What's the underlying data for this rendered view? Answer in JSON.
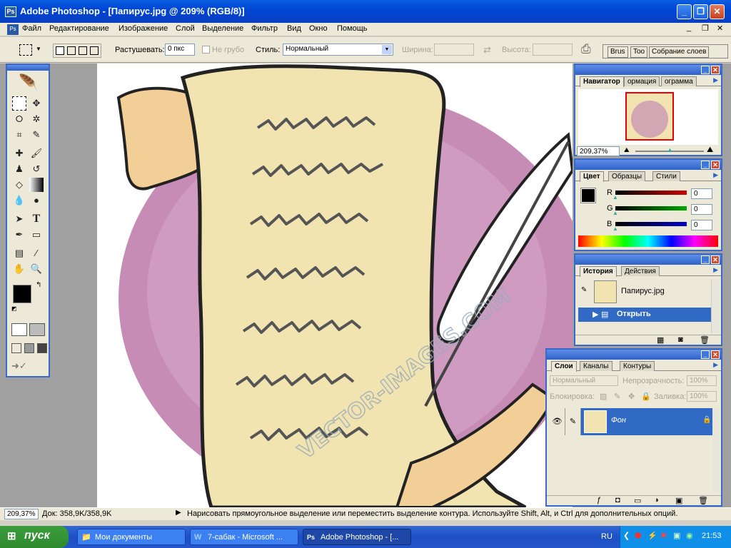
{
  "window": {
    "title": "Adobe Photoshop - [Папирус.jpg @ 209% (RGB/8)]",
    "app_icon": "photoshop-icon",
    "buttons": {
      "minimize": "_",
      "restore": "❐",
      "close": "✕"
    }
  },
  "menu": [
    "Файл",
    "Редактирование",
    "Изображение",
    "Слой",
    "Выделение",
    "Фильтр",
    "Вид",
    "Окно",
    "Помощь"
  ],
  "doc_controls": {
    "minimize": "_",
    "restore": "❐",
    "close": "✕"
  },
  "options": {
    "feather_label": "Растушевать:",
    "feather_value": "0 пкс",
    "antialias_label": "Не грубо",
    "style_label": "Стиль:",
    "style_value": "Нормальный",
    "width_label": "Ширина:",
    "height_label": "Высота:",
    "palette_tabs": [
      "Brus",
      "Too",
      "Собрание слоев"
    ]
  },
  "canvas": {
    "watermark": "VECTOR-IMAGES.COM",
    "colors": {
      "scroll": "#f2e4b0",
      "scroll_shadow": "#f2cf96",
      "circle": "#c68cb6",
      "outline": "#222222",
      "ink": "#555555",
      "feather": "#ffffff"
    }
  },
  "navigator": {
    "tabs": [
      "Навигатор",
      "ормация",
      "ограмма"
    ],
    "zoom": "209,37%"
  },
  "color_palette": {
    "tabs": [
      "Цвет",
      "Образцы",
      "Стили"
    ],
    "channels": [
      {
        "label": "R",
        "value": "0",
        "color": "#cc0000"
      },
      {
        "label": "G",
        "value": "0",
        "color": "#00aa00"
      },
      {
        "label": "B",
        "value": "0",
        "color": "#0000cc"
      }
    ]
  },
  "history": {
    "tabs": [
      "История",
      "Действия"
    ],
    "snapshot": "Папирус.jpg",
    "steps": [
      "Открыть"
    ]
  },
  "layers": {
    "tabs": [
      "Слои",
      "Каналы",
      "Контуры"
    ],
    "blend_mode": "Нормальный",
    "opacity_label": "Непрозрачность:",
    "opacity_value": "100%",
    "lock_label": "Блокировка:",
    "fill_label": "Заливка:",
    "fill_value": "100%",
    "items": [
      {
        "name": "Фон"
      }
    ]
  },
  "status": {
    "zoom": "209,37%",
    "doc": "Док: 358,9K/358,9K",
    "hint": "Нарисовать прямоугольное выделение или переместить выделение контура.  Используйте Shift, Alt, и Ctrl для дополнительных опций."
  },
  "taskbar": {
    "start": "пуск",
    "tasks": [
      {
        "label": "Мои документы",
        "icon": "folder-icon"
      },
      {
        "label": "7-сабак - Microsoft ...",
        "icon": "word-icon"
      },
      {
        "label": "Adobe Photoshop - [...",
        "icon": "photoshop-icon"
      }
    ],
    "lang": "RU",
    "clock": "21:53"
  }
}
